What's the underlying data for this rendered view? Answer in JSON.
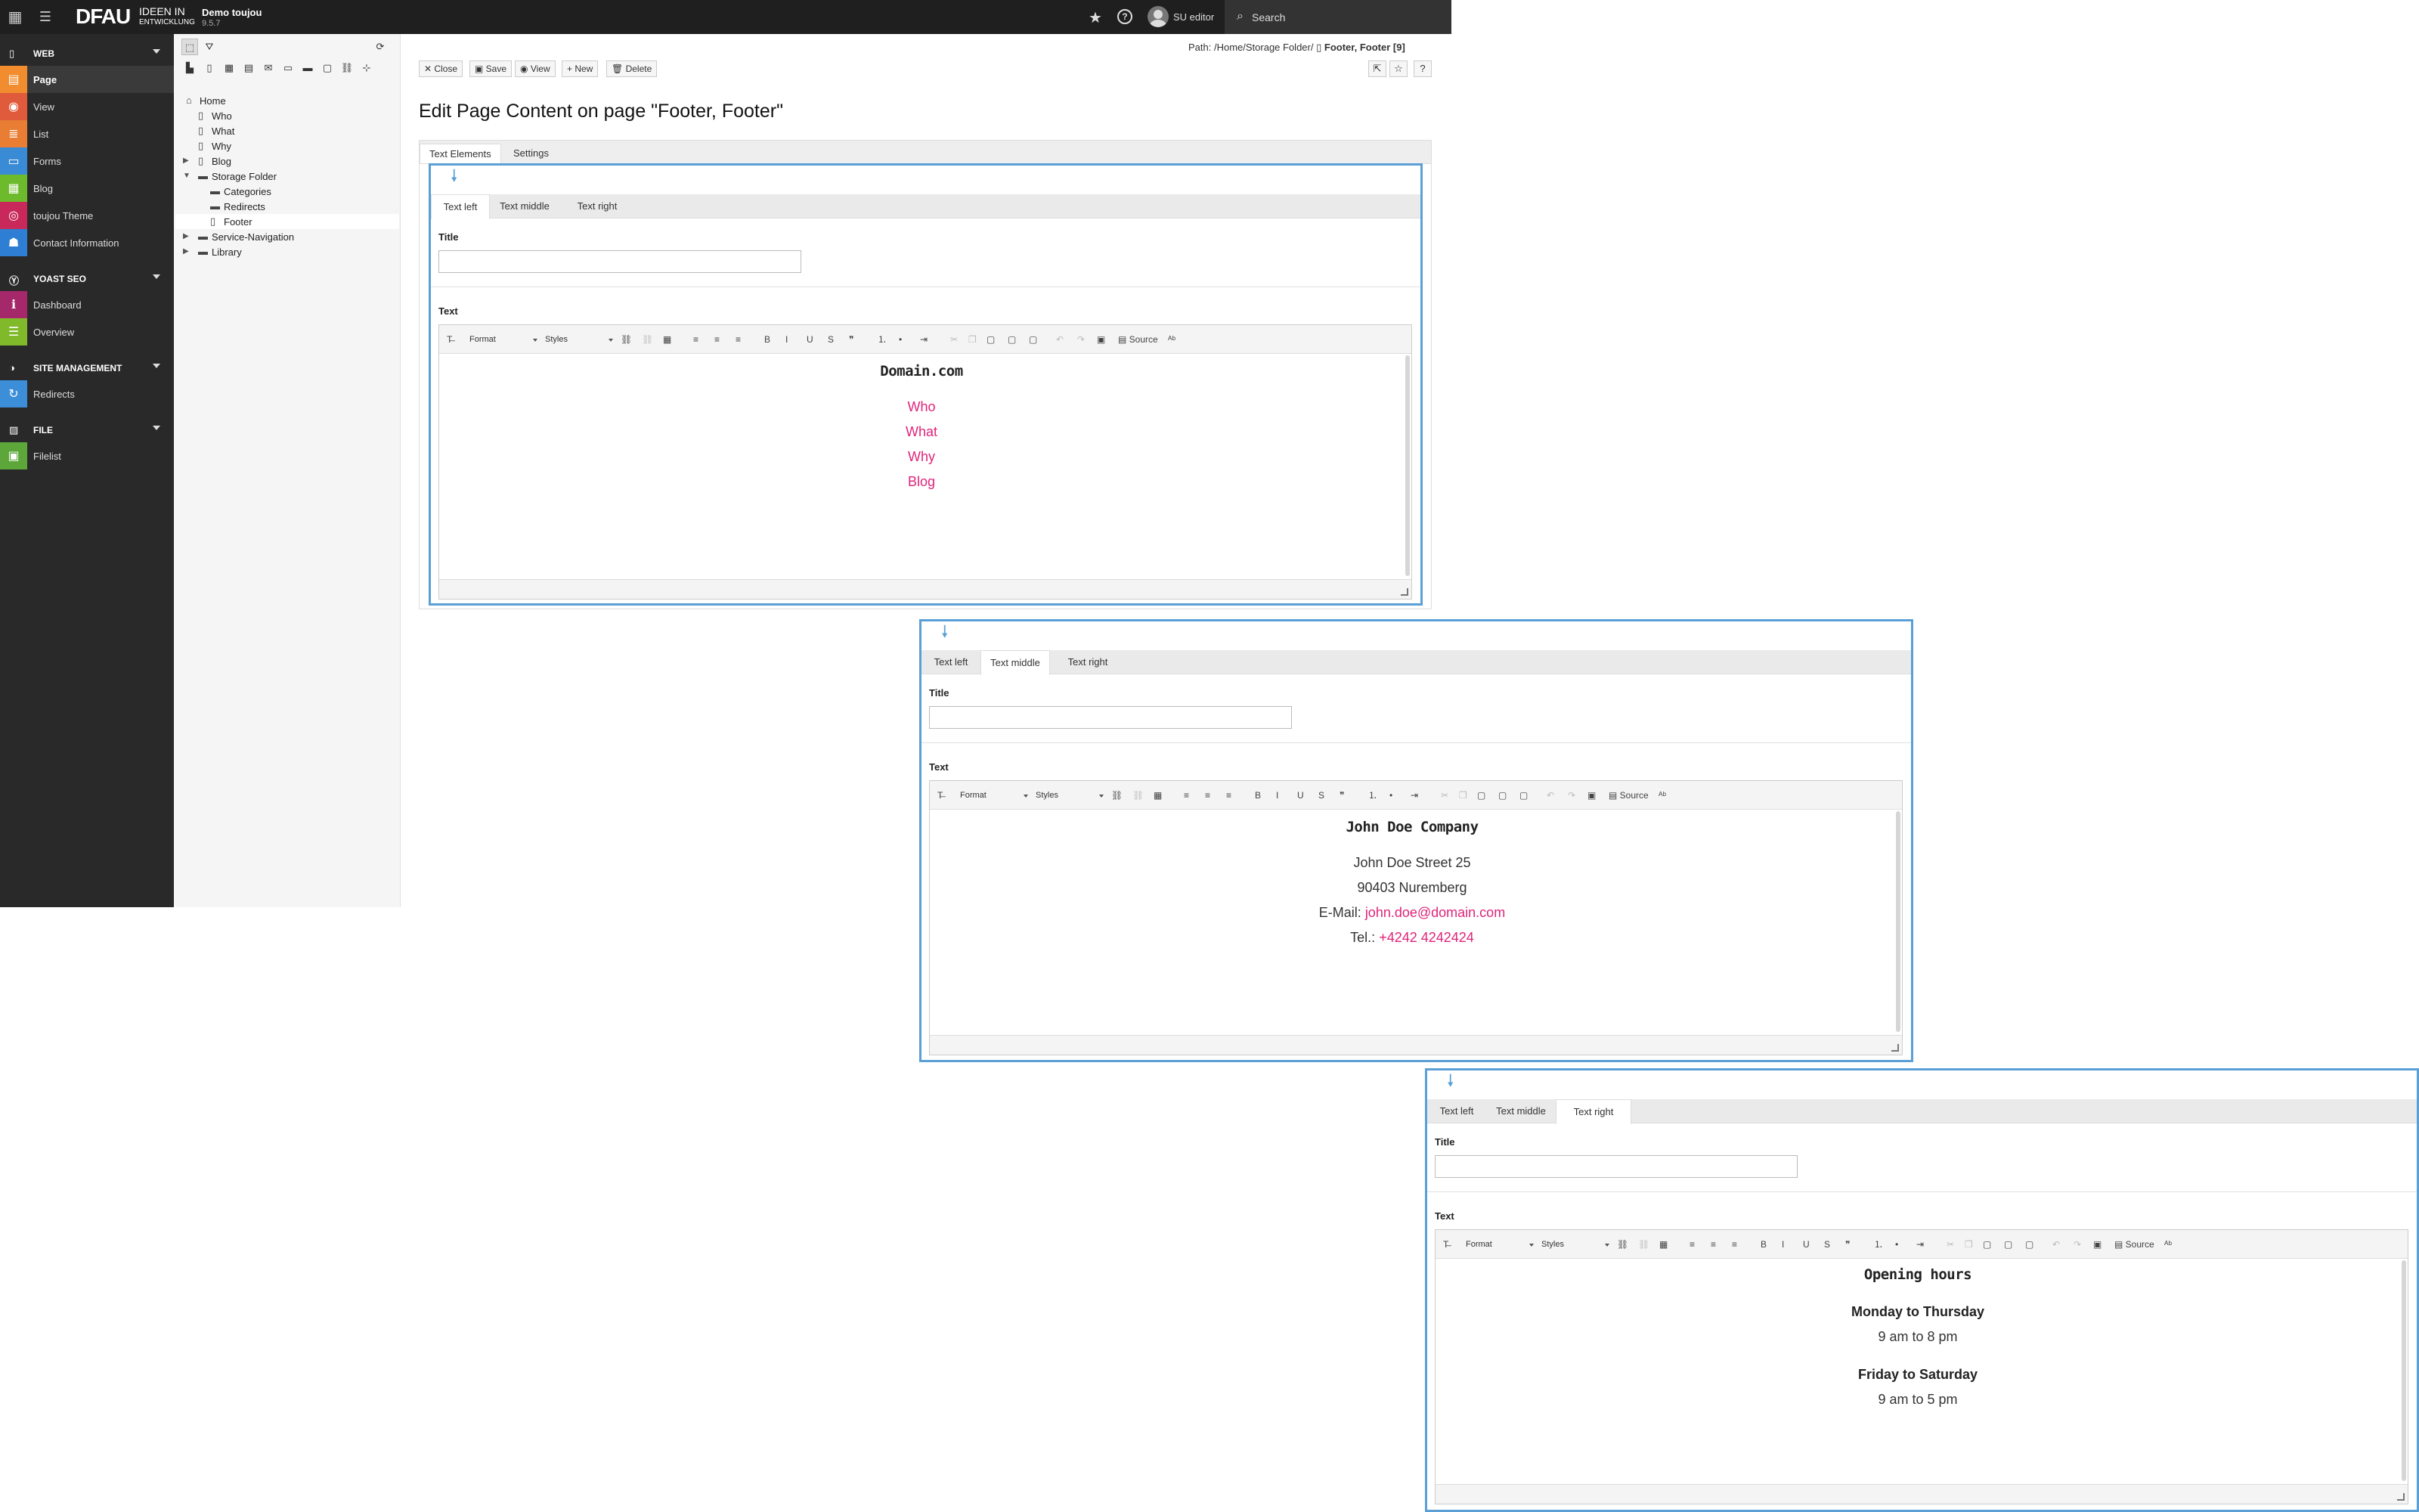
{
  "topbar": {
    "logo_text": "DFAU",
    "logo_tagline_1": "IDEEN IN",
    "logo_tagline_2": "ENTWICKLUNG",
    "site_name": "Demo toujou",
    "version": "9.5.7",
    "user_name": "SU editor",
    "search_placeholder": "Search"
  },
  "module_menu": {
    "groups": [
      {
        "label": "WEB",
        "items": [
          {
            "label": "Page",
            "color": "#f18c2f",
            "icon": "page-icon",
            "active": true
          },
          {
            "label": "View",
            "color": "#e05a3c",
            "icon": "eye-icon"
          },
          {
            "label": "List",
            "color": "#e87d33",
            "icon": "list-icon"
          },
          {
            "label": "Forms",
            "color": "#3a8bd6",
            "icon": "forms-icon"
          },
          {
            "label": "Blog",
            "color": "#6dbb2c",
            "icon": "blog-icon"
          },
          {
            "label": "toujou Theme",
            "color": "#c8285a",
            "icon": "fingerprint-icon"
          },
          {
            "label": "Contact Information",
            "color": "#2e7fd3",
            "icon": "contact-icon"
          }
        ]
      },
      {
        "label": "YOAST SEO",
        "items": [
          {
            "label": "Dashboard",
            "color": "#a4286a",
            "icon": "info-icon"
          },
          {
            "label": "Overview",
            "color": "#80b92a",
            "icon": "overview-icon"
          }
        ]
      },
      {
        "label": "SITE MANAGEMENT",
        "items": [
          {
            "label": "Redirects",
            "color": "#3c8ed8",
            "icon": "redirect-icon"
          }
        ]
      },
      {
        "label": "FILE",
        "items": [
          {
            "label": "Filelist",
            "color": "#5da73a",
            "icon": "filelist-icon"
          }
        ]
      }
    ]
  },
  "page_tree": {
    "nodes": [
      {
        "label": "Home",
        "icon": "home-icon"
      },
      {
        "label": "Who",
        "icon": "page-icon"
      },
      {
        "label": "What",
        "icon": "page-icon"
      },
      {
        "label": "Why",
        "icon": "page-icon"
      },
      {
        "label": "Blog",
        "icon": "page-icon",
        "collapsed": true
      },
      {
        "label": "Storage Folder",
        "icon": "folder-icon",
        "expanded": true
      },
      {
        "label": "Categories",
        "icon": "folder-icon"
      },
      {
        "label": "Redirects",
        "icon": "folder-icon"
      },
      {
        "label": "Footer",
        "icon": "page-icon",
        "selected": true
      },
      {
        "label": "Service-Navigation",
        "icon": "folder-icon",
        "collapsed": true
      },
      {
        "label": "Library",
        "icon": "folder-icon",
        "collapsed": true
      }
    ]
  },
  "docheader": {
    "path_prefix": "Path: /Home/Storage Folder/",
    "path_current": "Footer, Footer [9]",
    "buttons": {
      "close": "Close",
      "save": "Save",
      "view": "View",
      "new": "New",
      "delete": "Delete"
    }
  },
  "page_title": "Edit Page Content on page \"Footer, Footer\"",
  "outer_tabs": [
    "Text Elements",
    "Settings"
  ],
  "inner_tabs": [
    "Text left",
    "Text middle",
    "Text right"
  ],
  "field_labels": {
    "title": "Title",
    "text": "Text"
  },
  "rte_toolbar": {
    "format": "Format",
    "styles": "Styles",
    "source": "Source"
  },
  "panels": {
    "left": {
      "active_tab": "Text left",
      "heading": "Domain.com",
      "links": [
        "Who",
        "What",
        "Why",
        "Blog"
      ]
    },
    "middle": {
      "active_tab": "Text middle",
      "heading": "John Doe Company",
      "street": "John Doe Street 25",
      "city": "90403 Nuremberg",
      "email_label": "E-Mail: ",
      "email": "john.doe@domain.com",
      "phone_label": "Tel.: ",
      "phone": "+4242 4242424"
    },
    "right": {
      "active_tab": "Text right",
      "heading": "Opening hours",
      "days_1": "Monday to Thursday",
      "hours_1": "9 am to 8 pm",
      "days_2": "Friday to Saturday",
      "hours_2": "9 am to 5 pm"
    }
  },
  "colors": {
    "accent": "#5a9fd6",
    "link": "#e0237a"
  }
}
